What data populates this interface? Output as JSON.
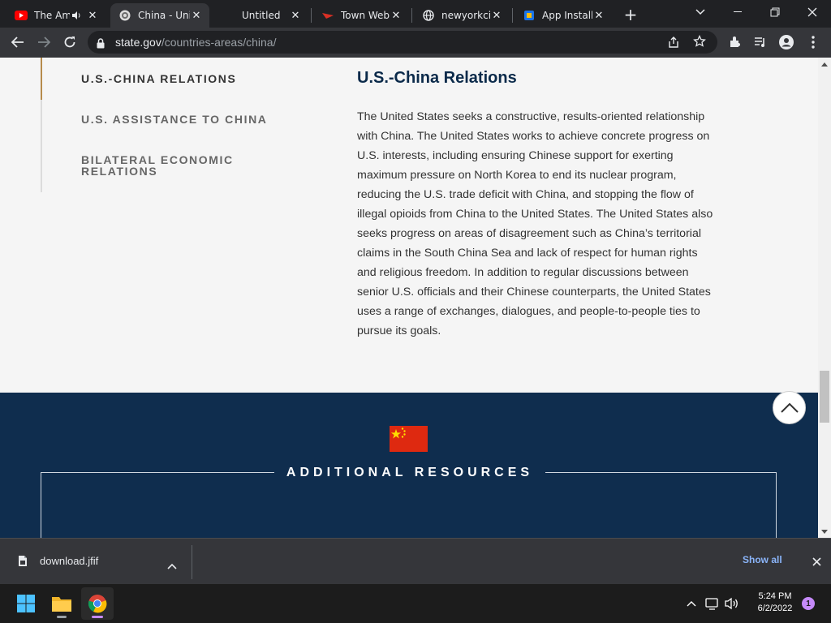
{
  "browser": {
    "tabs": [
      {
        "title": "The Am",
        "favicon": "youtube-icon",
        "audio": true,
        "active": false
      },
      {
        "title": "China - Uni",
        "favicon": "state-seal-icon",
        "active": true
      },
      {
        "title": "Untitled",
        "favicon": "none",
        "active": false
      },
      {
        "title": "Town Web",
        "favicon": "townweb-icon",
        "active": false
      },
      {
        "title": "newyorkcit",
        "favicon": "globe-icon",
        "active": false
      },
      {
        "title": "App Installe",
        "favicon": "app-install-icon",
        "active": false
      }
    ],
    "url_domain": "state.gov",
    "url_path": "/countries-areas/china/"
  },
  "page": {
    "sidebar": [
      {
        "label": "U.S.-CHINA RELATIONS",
        "active": true
      },
      {
        "label": "U.S. ASSISTANCE TO CHINA",
        "active": false
      },
      {
        "label": "BILATERAL ECONOMIC RELATIONS",
        "active": false
      }
    ],
    "section_title": "U.S.-China Relations",
    "section_body": "The United States seeks a constructive, results-oriented relationship with China. The United States works to achieve concrete progress on U.S. interests, including ensuring Chinese support for exerting maximum pressure on North Korea to end its nuclear program, reducing the U.S. trade deficit with China, and stopping the flow of illegal opioids from China to the United States. The United States also seeks progress on areas of disagreement such as China’s territorial claims in the South China Sea and lack of respect for human rights and religious freedom. In addition to regular discussions between senior U.S. officials and their Chinese counterparts, the United States uses a range of exchanges, dialogues, and people-to-people ties to pursue its goals.",
    "resources_title": "ADDITIONAL RESOURCES"
  },
  "downloads": {
    "file_name": "download.jfif",
    "show_all": "Show all"
  },
  "taskbar": {
    "time": "5:24 PM",
    "date": "6/2/2022",
    "notification_count": "1"
  },
  "colors": {
    "navy": "#0f2d4e",
    "accent_gold": "#b68b4c",
    "flag_red": "#de2910",
    "flag_star": "#ffde00"
  }
}
